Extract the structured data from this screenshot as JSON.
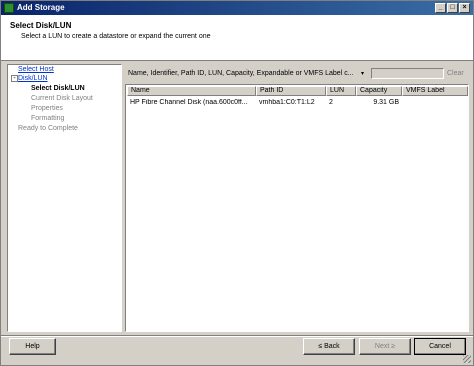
{
  "window": {
    "title": "Add Storage"
  },
  "header": {
    "title": "Select Disk/LUN",
    "subtitle": "Select a LUN to create a datastore or expand the current one"
  },
  "nav": {
    "items": [
      {
        "label": "Select Host",
        "state": "link"
      },
      {
        "label": "Disk/LUN",
        "state": "link"
      },
      {
        "label": "Select Disk/LUN",
        "state": "current"
      },
      {
        "label": "Current Disk Layout",
        "state": "disabled"
      },
      {
        "label": "Properties",
        "state": "disabled"
      },
      {
        "label": "Formatting",
        "state": "disabled"
      },
      {
        "label": "Ready to Complete",
        "state": "disabled"
      }
    ]
  },
  "filter": {
    "label": "Name, Identifier, Path ID, LUN, Capacity, Expandable or VMFS Label c...",
    "value": "",
    "clear_label": "Clear"
  },
  "table": {
    "columns": [
      "Name",
      "Path ID",
      "LUN",
      "Capacity",
      "VMFS Label"
    ],
    "rows": [
      {
        "name": "HP Fibre Channel Disk (naa.600c0ff...",
        "path_id": "vmhba1:C0:T1:L2",
        "lun": "2",
        "capacity": "9.31 GB",
        "vmfs_label": ""
      }
    ]
  },
  "buttons": {
    "help": "Help",
    "back": "≤ Back",
    "next": "Next ≥",
    "cancel": "Cancel"
  },
  "colors": {
    "titlebar": "#0a246a",
    "link": "#0033cc",
    "disabled": "#808080",
    "chrome": "#d4d0c8"
  }
}
